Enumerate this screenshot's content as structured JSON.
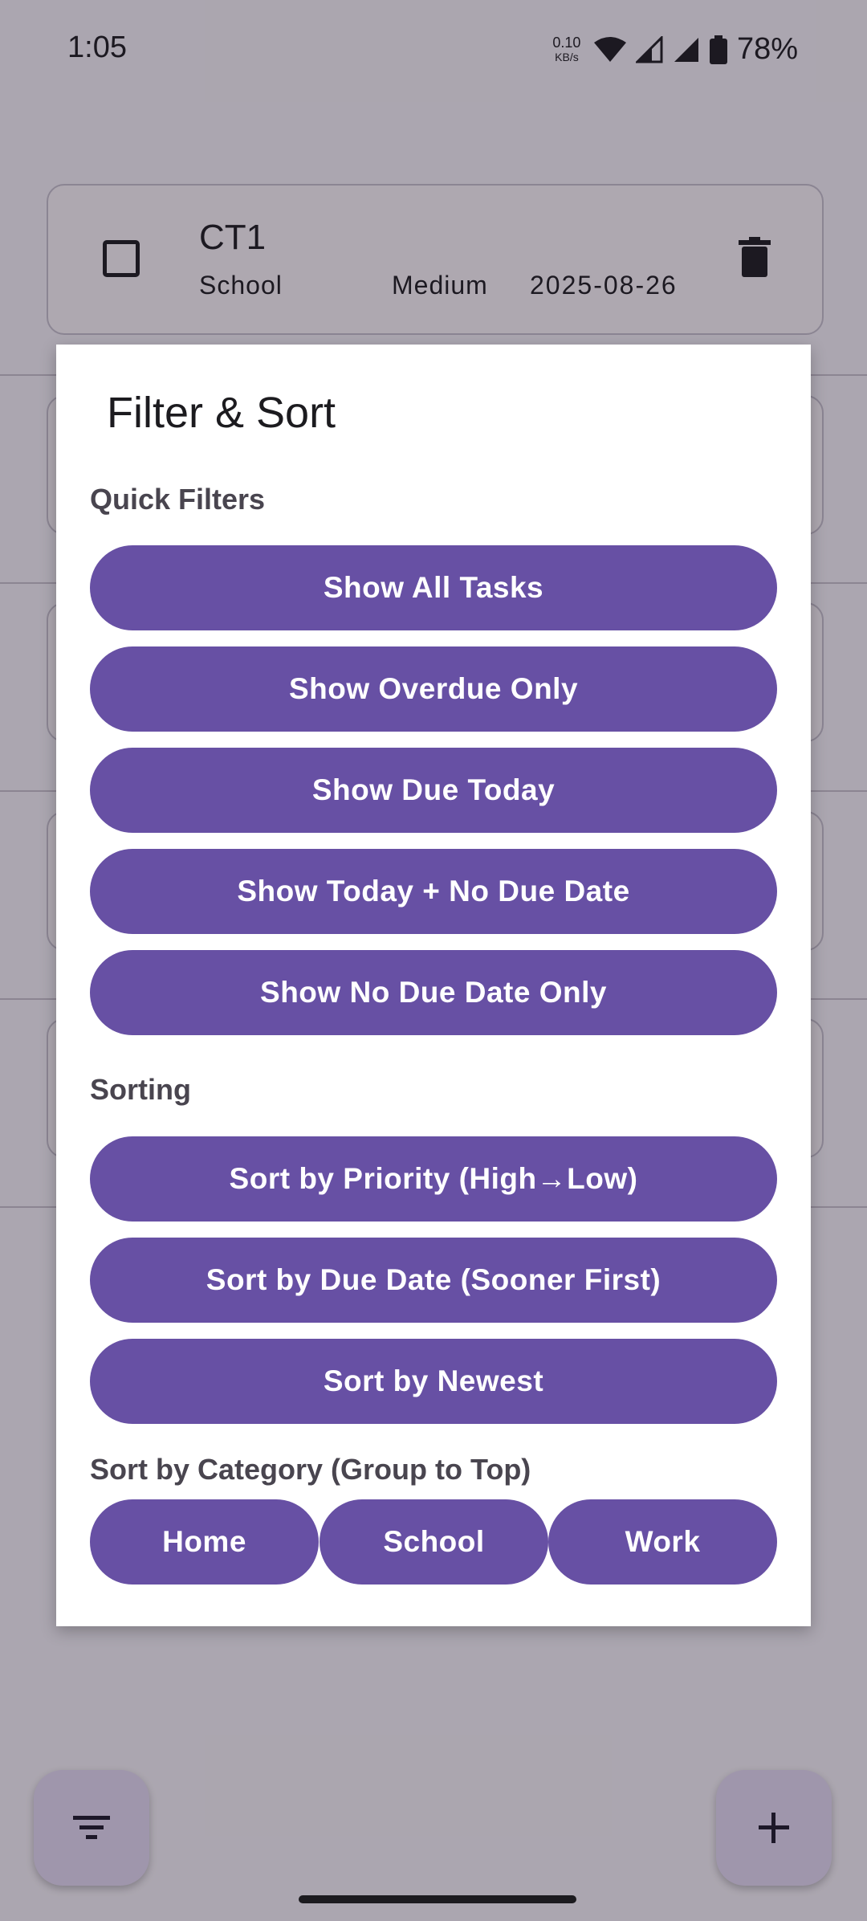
{
  "status_bar": {
    "time": "1:05",
    "net_speed_value": "0.10",
    "net_speed_unit": "KB/s",
    "battery": "78%"
  },
  "task": {
    "title": "CT1",
    "category": "School",
    "priority": "Medium",
    "due_date": "2025-08-26"
  },
  "dialog": {
    "title": "Filter & Sort",
    "quick_filters_label": "Quick Filters",
    "quick_filters": [
      "Show All Tasks",
      "Show Overdue Only",
      "Show Due Today",
      "Show Today + No Due Date",
      "Show No Due Date Only"
    ],
    "sorting_label": "Sorting",
    "sorting": [
      "Sort by Priority (High→Low)",
      "Sort by Due Date (Sooner First)",
      "Sort by Newest"
    ],
    "category_label": "Sort by Category (Group to Top)",
    "categories": [
      "Home",
      "School",
      "Work"
    ]
  },
  "colors": {
    "primary": "#6750a4",
    "on_primary": "#ffffff",
    "fab_container": "#e8def8"
  },
  "icons": {
    "filter_fab": "filter-icon",
    "add_fab": "add-icon",
    "delete": "delete-icon"
  }
}
